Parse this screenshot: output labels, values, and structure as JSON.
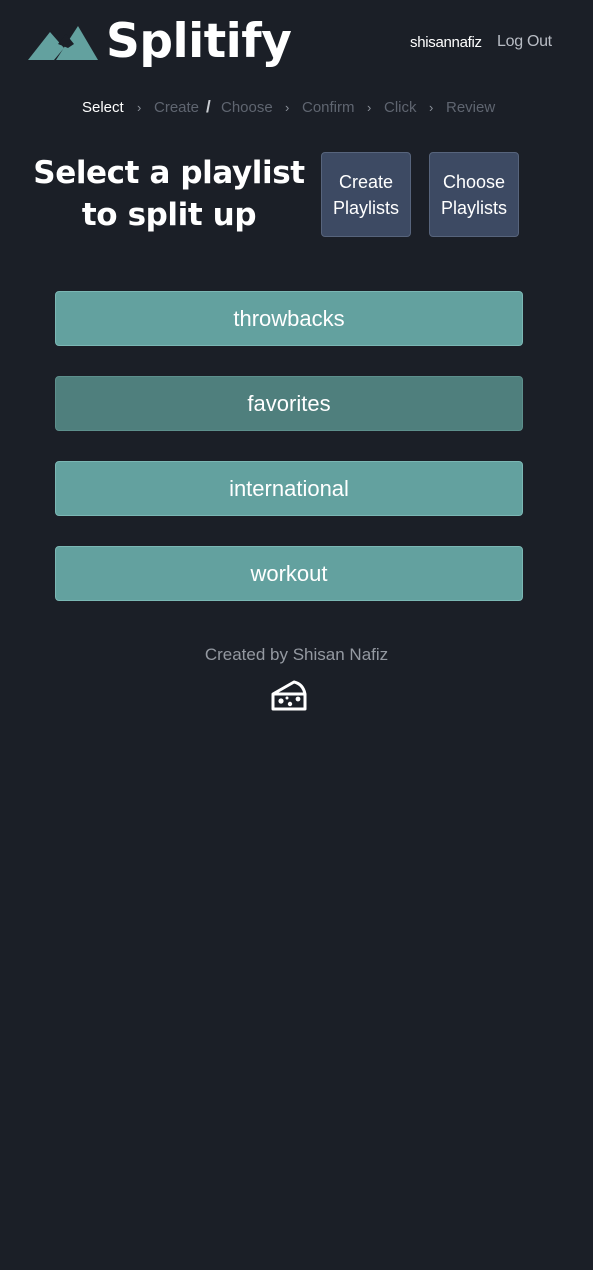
{
  "header": {
    "brand": "Splitify",
    "username": "shisannafiz",
    "logout_label": "Log Out"
  },
  "steps": {
    "items": [
      "Select",
      "Create",
      "Choose",
      "Confirm",
      "Click",
      "Review"
    ],
    "active": "Select"
  },
  "main": {
    "title_line1": "Select a playlist",
    "title_line2": "to split up",
    "create_button": {
      "line1": "Create",
      "line2": "Playlists"
    },
    "choose_button": {
      "line1": "Choose",
      "line2": "Playlists"
    }
  },
  "playlists": [
    {
      "name": "throwbacks"
    },
    {
      "name": "favorites"
    },
    {
      "name": "international"
    },
    {
      "name": "workout"
    }
  ],
  "footer": {
    "credit": "Created by Shisan Nafiz",
    "icon": "cheese-icon"
  },
  "colors": {
    "background": "#1b1f27",
    "accent": "#63a19f",
    "accent_hover": "#4f7f7d",
    "button": "#3d4a63"
  }
}
